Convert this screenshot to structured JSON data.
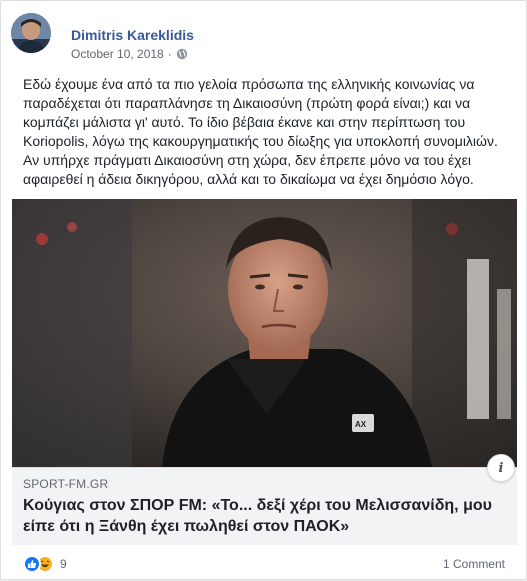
{
  "post": {
    "author": "Dimitris Kareklidis",
    "date": "October 10, 2018",
    "separator": "·",
    "privacy_icon": "globe-icon",
    "text": "Εδώ έχουμε ένα από τα πιο γελοία πρόσωπα της ελληνικής κοινωνίας να παραδέχεται ότι παραπλάνησε τη Δικαιοσύνη (πρώτη φορά είναι;) και να κομπάζει μάλιστα γι' αυτό. Το ίδιο βέβαια έκανε και στην περίπτωση του Koriopolis, λόγω της κακουργηματικής του δίωξης για υποκλοπή συνομιλιών. Αν υπήρχε πράγματι Δικαιοσύνη στη χώρα, δεν έπρεπε μόνο να του έχει αφαιρεθεί η άδεια δικηγόρου, αλλά και το δικαίωμα να έχει δημόσιο λόγο."
  },
  "link": {
    "domain": "SPORT-FM.GR",
    "title": "Κούγιας στον ΣΠΟΡ FM: «Το... δεξί χέρι του Μελισσανίδη, μου είπε ότι η Ξάνθη έχει πωληθεί στον ΠΑΟΚ»",
    "info_label": "i"
  },
  "footer": {
    "reaction_count": "9",
    "comments": "1 Comment",
    "reaction_icons": [
      "like-icon",
      "haha-icon"
    ]
  },
  "colors": {
    "author_link": "#385898",
    "like_blue": "#1877f2",
    "haha_yellow": "#f7b125"
  }
}
